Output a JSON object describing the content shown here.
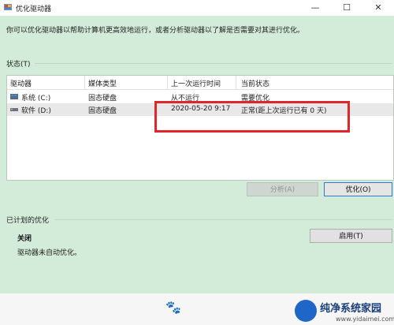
{
  "window": {
    "title": "优化驱动器",
    "controls": {
      "minimize": "—",
      "maximize": "☐",
      "close": "✕"
    }
  },
  "intro_text": "你可以优化驱动器以帮助计算机更高效地运行，或者分析驱动器以了解是否需要对其进行优化。",
  "status": {
    "label": "状态(T)",
    "columns": [
      "驱动器",
      "媒体类型",
      "上一次运行时间",
      "当前状态"
    ],
    "rows": [
      {
        "drive": "系统 (C:)",
        "media": "固态硬盘",
        "last_run": "从不运行",
        "state": "需要优化"
      },
      {
        "drive": "软件 (D:)",
        "media": "固态硬盘",
        "last_run": "2020-05-20 9:17",
        "state": "正常(距上次运行已有 0 天)"
      }
    ]
  },
  "buttons": {
    "analyze": "分析(A)",
    "optimize": "优化(O)",
    "enable": "启用(T)"
  },
  "schedule": {
    "label": "已计划的优化",
    "state": "关闭",
    "desc": "驱动器未自动优化。"
  },
  "watermark": {
    "title": "纯净系统家园",
    "url": "www.yidaimei.com"
  },
  "colors": {
    "window_bg": "#d3ecd9",
    "highlight_box": "#e0252b",
    "focus_border": "#2f7ad6"
  }
}
